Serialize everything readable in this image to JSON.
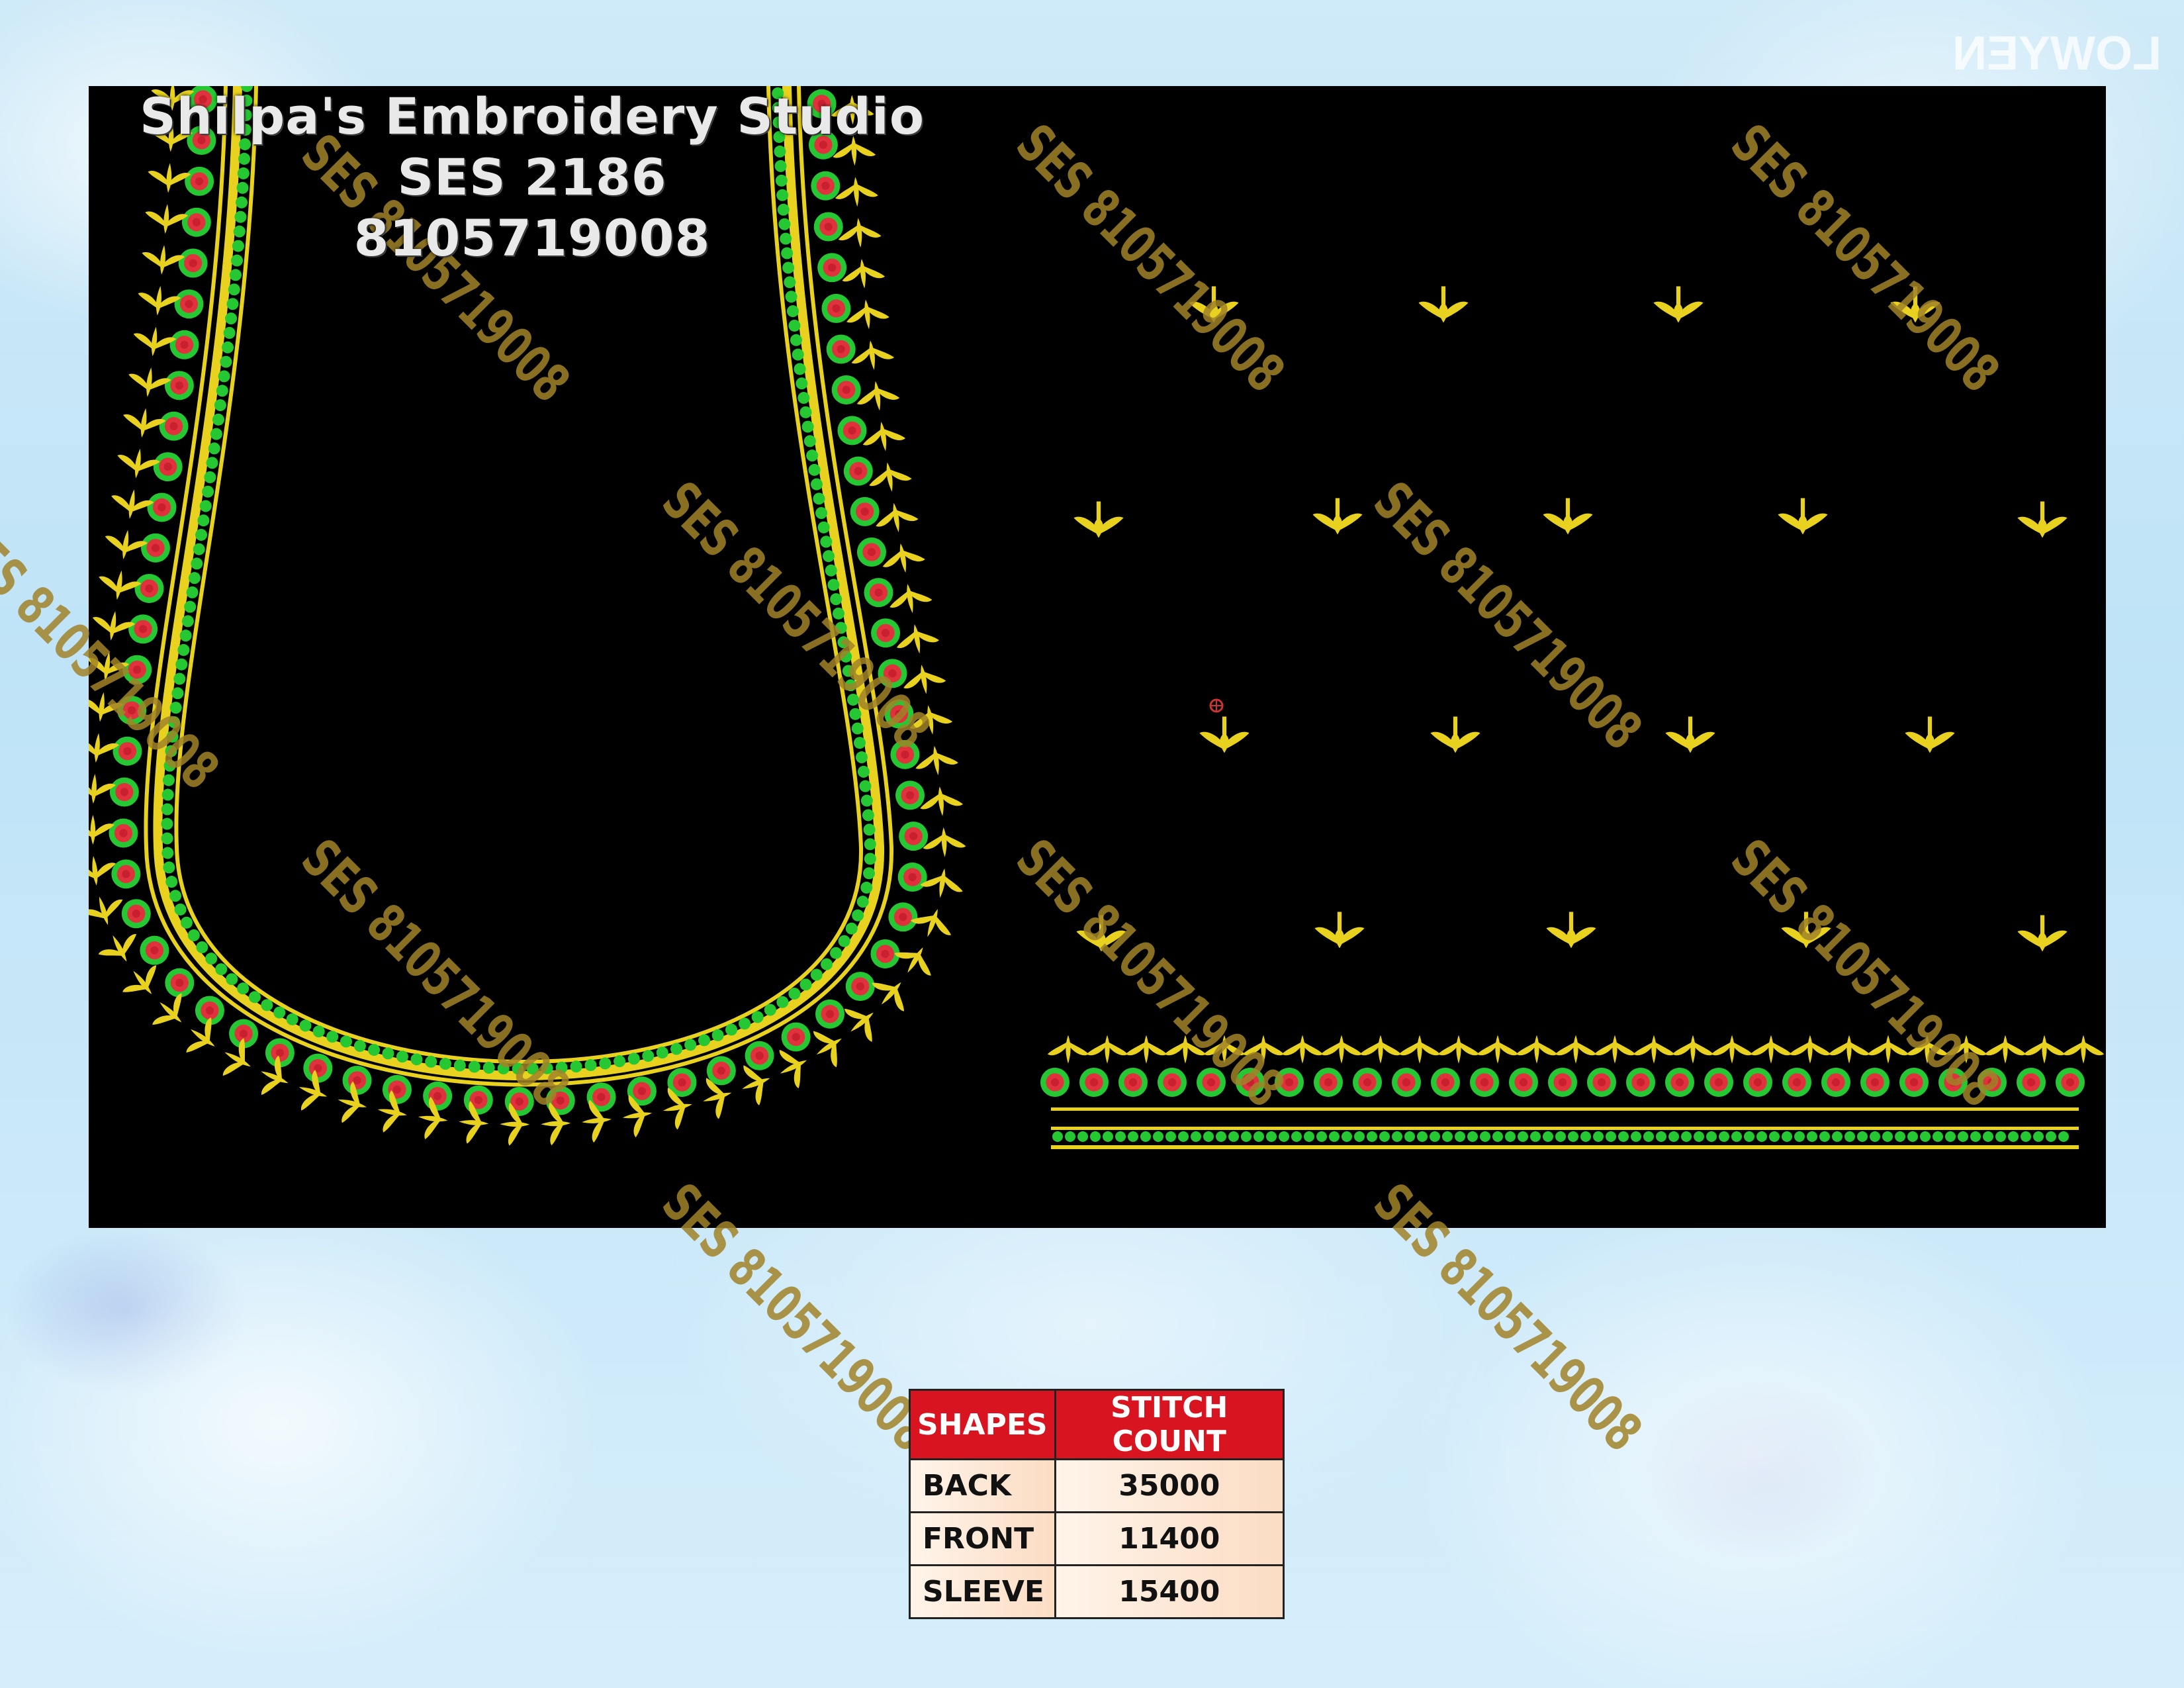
{
  "corner_logo": "LOWYEN",
  "header": {
    "studio_name": "Shilpa's Embroidery Studio",
    "design_code": "SES 2186",
    "phone": "8105719008"
  },
  "watermark_text": "SES 8105719008",
  "colors": {
    "background": "#000000",
    "gold": "#e8d21f",
    "green": "#25c832",
    "red": "#e0323c",
    "table_header": "#d7141f"
  },
  "table": {
    "headers": [
      "SHAPES",
      "STITCH COUNT"
    ],
    "rows": [
      {
        "shape": "BACK",
        "count": "35000"
      },
      {
        "shape": "FRONT",
        "count": "11400"
      },
      {
        "shape": "SLEEVE",
        "count": "15400"
      }
    ]
  }
}
